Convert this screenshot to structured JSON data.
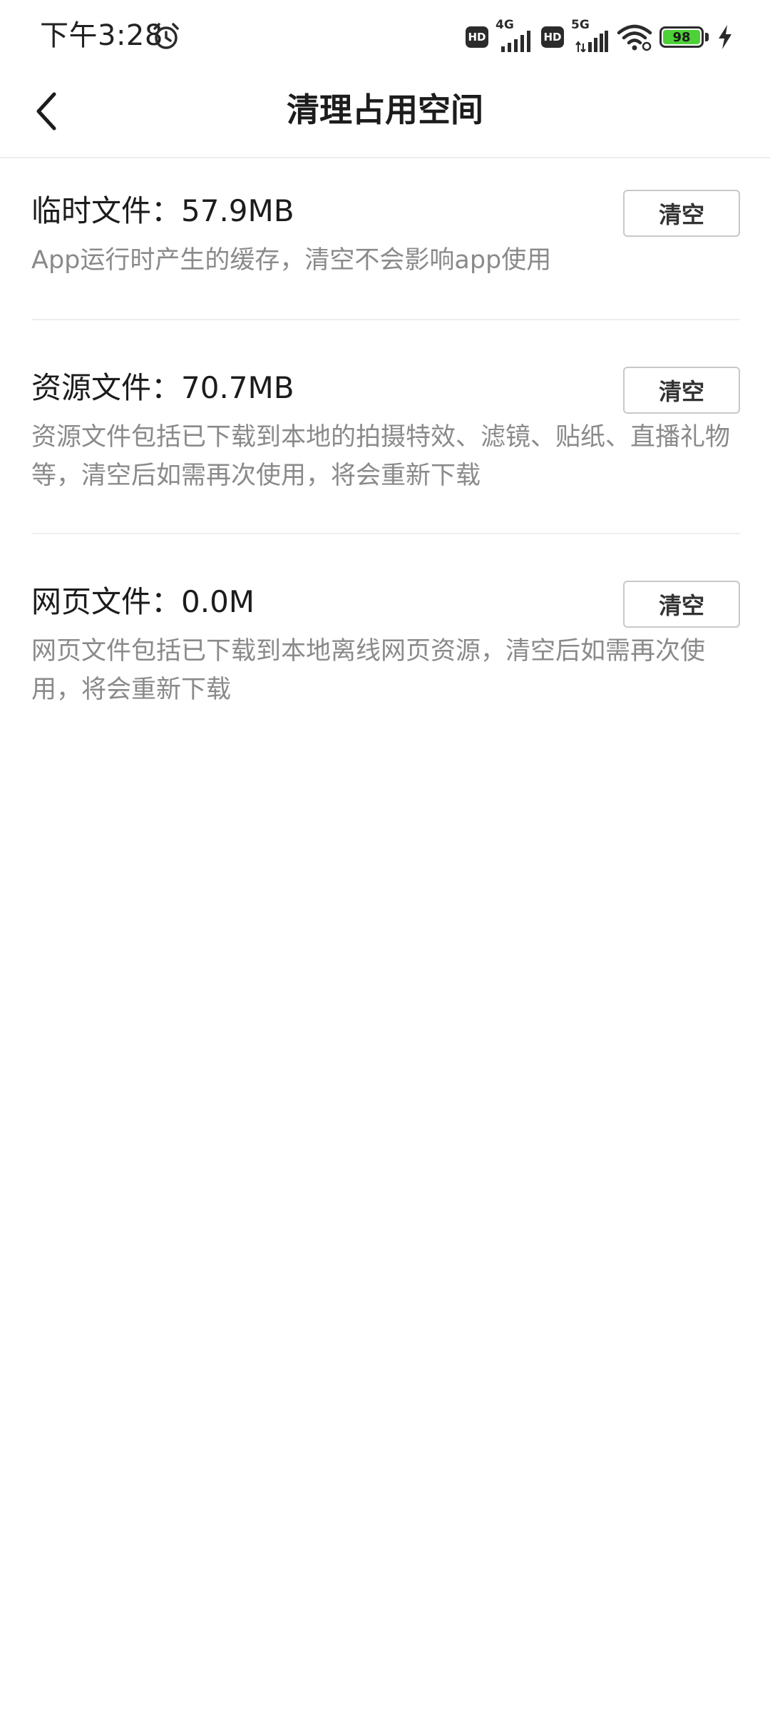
{
  "status_bar": {
    "time": "下午3:28",
    "hd_label": "HD",
    "network_1": "4G",
    "network_2": "5G",
    "battery_level": "98",
    "colors": {
      "battery_fill": "#4cd137",
      "icon": "#2b2b2b"
    }
  },
  "header": {
    "title": "清理占用空间",
    "back_icon": "chevron-left-icon"
  },
  "sections": [
    {
      "title": "临时文件：57.9MB",
      "description": "App运行时产生的缓存，清空不会影响app使用",
      "button_label": "清空"
    },
    {
      "title": "资源文件：70.7MB",
      "description": "资源文件包括已下载到本地的拍摄特效、滤镜、贴纸、直播礼物等，清空后如需再次使用，将会重新下载",
      "button_label": "清空"
    },
    {
      "title": "网页文件：0.0M",
      "description": "网页文件包括已下载到本地离线网页资源，清空后如需再次使用，将会重新下载",
      "button_label": "清空"
    }
  ],
  "colors": {
    "description_text": "#8a8a8a",
    "divider": "#eeeeee",
    "button_border": "#c8c8c8"
  }
}
